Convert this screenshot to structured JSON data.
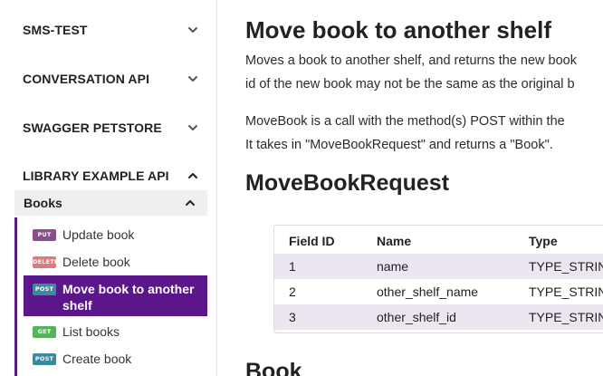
{
  "sidebar": {
    "sections": [
      {
        "label": "SMS-TEST",
        "icon": "chevron-down-icon"
      },
      {
        "label": "CONVERSATION API",
        "icon": "chevron-down-icon"
      },
      {
        "label": "SWAGGER PETSTORE",
        "icon": "chevron-down-icon"
      },
      {
        "label": "LIBRARY EXAMPLE API",
        "icon": "chevron-up-icon"
      }
    ],
    "group": {
      "label": "Books",
      "icon": "chevron-up-icon"
    },
    "items": [
      {
        "method": "PUT",
        "label": "Update book"
      },
      {
        "method": "DELETE",
        "label": "Delete book"
      },
      {
        "method": "POST",
        "label": "Move book to another shelf",
        "active": true
      },
      {
        "method": "GET",
        "label": "List books"
      },
      {
        "method": "POST",
        "label": "Create book"
      }
    ]
  },
  "main": {
    "title": "Move book to another shelf",
    "desc_line1": "Moves a book to another shelf, and returns the new book",
    "desc_line2": "id of the new book may not be the same as the original b",
    "call_line1": "MoveBook is a call with the method(s) POST within the",
    "call_line2": "It takes in \"MoveBookRequest\" and returns a \"Book\".",
    "request_heading": "MoveBookRequest",
    "table": {
      "headers": [
        "Field ID",
        "Name",
        "Type"
      ],
      "rows": [
        [
          "1",
          "name",
          "TYPE_STRIN"
        ],
        [
          "2",
          "other_shelf_name",
          "TYPE_STRIN"
        ],
        [
          "3",
          "other_shelf_id",
          "TYPE_STRIN"
        ]
      ]
    },
    "next_heading": "Book"
  },
  "colors": {
    "accent": "#5b168a",
    "badge_put": "#8b4d8f",
    "badge_delete": "#e07a7a",
    "badge_post": "#3c8aa0",
    "badge_get": "#55b35a",
    "table_shade": "#ece6f1"
  }
}
